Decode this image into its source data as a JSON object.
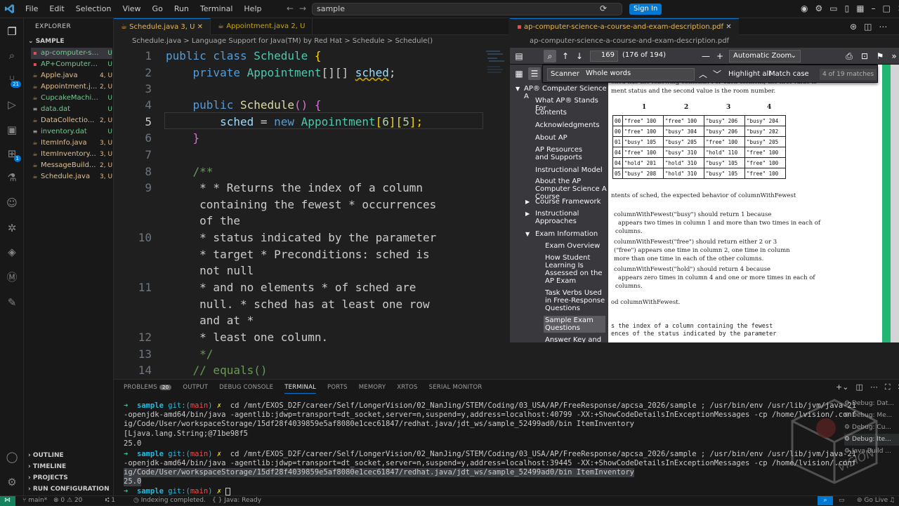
{
  "titlebar": {
    "menu": [
      "File",
      "Edit",
      "Selection",
      "View",
      "Go",
      "Run",
      "Terminal",
      "Help"
    ],
    "search": "sample",
    "signin": "Sign In"
  },
  "sidebar": {
    "header": "EXPLORER",
    "project": "SAMPLE",
    "files": [
      {
        "name": "ap-computer-sci...",
        "status": "U"
      },
      {
        "name": "AP+Computer+S...",
        "status": "U"
      },
      {
        "name": "Apple.java",
        "status": "4, U"
      },
      {
        "name": "Appointment.j...",
        "status": "2, U"
      },
      {
        "name": "CupcakeMachi...",
        "status": "U"
      },
      {
        "name": "data.dat",
        "status": "U"
      },
      {
        "name": "DataCollectio...",
        "status": "2, U"
      },
      {
        "name": "inventory.dat",
        "status": "U"
      },
      {
        "name": "ItemInfo.java",
        "status": "3, U"
      },
      {
        "name": "ItemInventory...",
        "status": "3, U"
      },
      {
        "name": "MessageBuild...",
        "status": "2, U"
      },
      {
        "name": "Schedule.java",
        "status": "3, U"
      }
    ],
    "sections": [
      "OUTLINE",
      "TIMELINE",
      "PROJECTS",
      "RUN CONFIGURATION"
    ]
  },
  "activity_badges": {
    "scm": "21",
    "ext": "1"
  },
  "editor": {
    "tabs": [
      {
        "label": "Schedule.java 3, U"
      },
      {
        "label": "Appointment.java 2, U"
      }
    ],
    "breadcrumb": "Schedule.java > Language Support for Java(TM) by Red Hat > Schedule > Schedule()",
    "line_numbers": [
      "1",
      "2",
      "3",
      "4",
      "5",
      "6",
      "7",
      "8",
      "9",
      "",
      "",
      "10",
      "",
      "11",
      "",
      "",
      "12",
      "13",
      "14"
    ],
    "code": {
      "l1_kw": "public class ",
      "l1_ty": "Schedule",
      "l1_rest": " {",
      "l2_kw": "    private ",
      "l2_ty": "Appointment",
      "l2_br": "[][] ",
      "l2_va": "sched",
      "l2_end": ";",
      "l4_kw": "    public ",
      "l4_fn": "Schedule",
      "l4_rest": "() {",
      "l5_va": "        sched",
      "l5_eq": " = ",
      "l5_kw": "new ",
      "l5_ty": "Appointment",
      "l5_b1": "[",
      "l5_n1": "6",
      "l5_b2": "][",
      "l5_n2": "5",
      "l5_b3": "];",
      "l6": "    }",
      "l8": "    /**",
      "l9a": "     * * Returns the index of a column",
      "l9b": "     containing the fewest * occurrences",
      "l9c": "     of the",
      "l10a": "     * status indicated by the parameter",
      "l10b": "     * target * Preconditions: sched is",
      "l10c": "     not null",
      "l11a": "     * and no elements * of sched are",
      "l11b": "     null. * sched has at least one row",
      "l11c": "     and at *",
      "l12": "     * least one column.",
      "l13": "     */",
      "l14": "    // equals()"
    }
  },
  "pdf": {
    "tab": "ap-computer-science-a-course-and-exam-description.pdf",
    "breadcrumb": "ap-computer-science-a-course-and-exam-description.pdf",
    "page": "169",
    "page_of": "(176 of 194)",
    "zoom": "Automatic Zoom",
    "find": {
      "query": "Scanner",
      "highlight_all": "Highlight all",
      "match_case": "Match case",
      "whole_words": "Whole words",
      "count": "4 of 19 matches"
    },
    "outline": [
      "AP® Computer Science A",
      "What AP® Stands For",
      "Contents",
      "Acknowledgments",
      "About AP",
      "AP Resources and Supports",
      "Instructional Model",
      "About the AP Computer Science A Course",
      "Course Framework",
      "Instructional Approaches",
      "Exam Information",
      "Exam Overview",
      "How Student Learning Is Assessed on the AP Exam",
      "Task Verbs Used in Free-Response Questions",
      "Sample Exam Questions",
      "Answer Key and"
    ],
    "page_text": {
      "line1": "ched  has the following contents. For each element, the first value is",
      "line2": "ment status and the second value is the room number.",
      "col_heads": [
        "1",
        "2",
        "3",
        "4"
      ],
      "rows": [
        [
          "00",
          "\"free\"  100",
          "\"free\"  100",
          "\"busy\"  206",
          "\"busy\"  204"
        ],
        [
          "00",
          "\"free\"  100",
          "\"busy\"  304",
          "\"busy\"  206",
          "\"busy\"  202"
        ],
        [
          "01",
          "\"busy\"  105",
          "\"busy\"  205",
          "\"free\"  100",
          "\"busy\"  205"
        ],
        [
          "04",
          "\"free\"  100",
          "\"busy\"  310",
          "\"hold\"  110",
          "\"free\"  100"
        ],
        [
          "04",
          "\"hold\"  201",
          "\"hold\"  310",
          "\"busy\"  105",
          "\"free\"  100"
        ],
        [
          "05",
          "\"busy\"  208",
          "\"hold\"  310",
          "\"busy\"  105",
          "\"free\"  100"
        ]
      ],
      "p1": "ntents of  sched,  the expected behavior of  columnWithFewest",
      "p2a": "columnWithFewest(\"busy\")  should return  1  because",
      "p2b": "appears two times in column  1  and more than two times in each of",
      "p2c": "columns.",
      "p3a": "columnWithFewest(\"free\")  should return either  2  or  3",
      "p3b": "(\"free\")  appears one time in column  2,  one time in column",
      "p3c": "more than one time in each of the other columns.",
      "p4a": "columnWithFewest(\"hold\")  should return  4  because",
      "p4b": "appears zero times in column  4  and one or more times in each of",
      "p4c": "columns.",
      "p5": "od  columnWithFewest.",
      "p6a": "s the index of a column containing the fewest",
      "p6b": "ences of the status indicated by the parameter"
    }
  },
  "panel": {
    "tabs": [
      "PROBLEMS",
      "OUTPUT",
      "DEBUG CONSOLE",
      "TERMINAL",
      "PORTS",
      "MEMORY",
      "XRTOS",
      "SERIAL MONITOR"
    ],
    "problems_count": "20",
    "terminal": {
      "prompt_arrow": "➜",
      "prompt_dir": "sample",
      "prompt_git": "git:(",
      "prompt_branch": "main",
      "prompt_close": ")",
      "prompt_x": "✗",
      "cmd1a": "cd /mnt/EXOS_D2F/career/Self/LongerVision/02_NanJing/STEM/Coding/03_USA/AP/FreeResponse/apcsa_2026/sample ; /usr/bin/env /usr/lib/jvm/java-21",
      "cmd1b": "-openjdk-amd64/bin/java -agentlib:jdwp=transport=dt_socket,server=n,suspend=y,address=localhost:40799 -XX:+ShowCodeDetailsInExceptionMessages -cp /home/lvision/.conf",
      "cmd1c": "ig/Code/User/workspaceStorage/15df28f4039859e5af8080e1cec61847/redhat.java/jdt_ws/sample_52499ad0/bin ItemInventory",
      "out1a": "[Ljava.lang.String;@71be98f5",
      "out1b": "25.0",
      "cmd2a": "cd /mnt/EXOS_D2F/career/Self/LongerVision/02_NanJing/STEM/Coding/03_USA/AP/FreeResponse/apcsa_2026/sample ; /usr/bin/env /usr/lib/jvm/java-21",
      "cmd2b": "-openjdk-amd64/bin/java -agentlib:jdwp=transport=dt_socket,server=n,suspend=y,address=localhost:39445 -XX:+ShowCodeDetailsInExceptionMessages -cp /home/lvision/.conf",
      "cmd2c": "ig/Code/User/workspaceStorage/15df28f4039859e5af8080e1cec61847/redhat.java/jdt_ws/sample_52499ad0/bin ItemInventory",
      "out2": "25.0"
    },
    "debug_sessions": [
      "Debug: Dat...",
      "Debug: Me...",
      "Debug: Cu...",
      "Debug: Ite...",
      "Java Build ..."
    ]
  },
  "statusbar": {
    "branch": "main*",
    "errors": "0",
    "warnings": "20",
    "ports": "1",
    "indexing": "Indexing completed.",
    "java": "Java: Ready",
    "golive": "Go Live"
  },
  "watermark": "VISION"
}
